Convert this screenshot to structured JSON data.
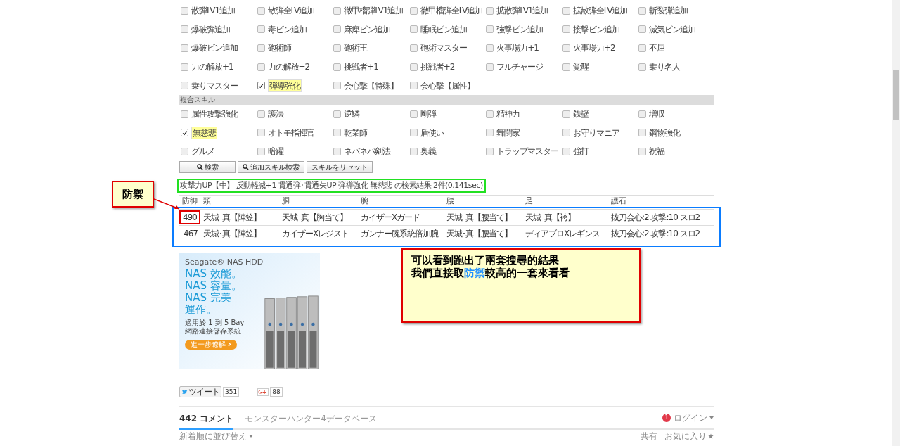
{
  "skill_sections": [
    {
      "items": [
        {
          "label": "散弾LV1追加",
          "checked": false
        },
        {
          "label": "散弾全LV追加",
          "checked": false
        },
        {
          "label": "徹甲榴弾LV1追加",
          "checked": false
        },
        {
          "label": "徹甲榴弾全LV追加",
          "checked": false
        },
        {
          "label": "拡散弾LV1追加",
          "checked": false
        },
        {
          "label": "拡散弾全LV追加",
          "checked": false
        },
        {
          "label": "斬裂弾追加",
          "checked": false
        },
        {
          "label": "爆破弾追加",
          "checked": false
        },
        {
          "label": "毒ビン追加",
          "checked": false
        },
        {
          "label": "麻痺ビン追加",
          "checked": false
        },
        {
          "label": "睡眠ビン追加",
          "checked": false
        },
        {
          "label": "強撃ビン追加",
          "checked": false
        },
        {
          "label": "接撃ビン追加",
          "checked": false
        },
        {
          "label": "減気ビン追加",
          "checked": false
        },
        {
          "label": "爆破ビン追加",
          "checked": false
        },
        {
          "label": "砲術師",
          "checked": false
        },
        {
          "label": "砲術王",
          "checked": false
        },
        {
          "label": "砲術マスター",
          "checked": false
        },
        {
          "label": "火事場力+1",
          "checked": false
        },
        {
          "label": "火事場力+2",
          "checked": false
        },
        {
          "label": "不屈",
          "checked": false
        },
        {
          "label": "力の解放+1",
          "checked": false
        },
        {
          "label": "力の解放+2",
          "checked": false
        },
        {
          "label": "挑戦者+1",
          "checked": false
        },
        {
          "label": "挑戦者+2",
          "checked": false
        },
        {
          "label": "フルチャージ",
          "checked": false
        },
        {
          "label": "覚醒",
          "checked": false
        },
        {
          "label": "乗り名人",
          "checked": false
        },
        {
          "label": "乗りマスター",
          "checked": false
        },
        {
          "label": "弾導強化",
          "checked": true
        },
        {
          "label": "会心撃【特殊】",
          "checked": false
        },
        {
          "label": "会心撃【属性】",
          "checked": false
        }
      ]
    },
    {
      "title": "複合スキル",
      "items": [
        {
          "label": "属性攻撃強化",
          "checked": false
        },
        {
          "label": "護法",
          "checked": false
        },
        {
          "label": "逆鱗",
          "checked": false
        },
        {
          "label": "剛弾",
          "checked": false
        },
        {
          "label": "精神力",
          "checked": false
        },
        {
          "label": "鉄壁",
          "checked": false
        },
        {
          "label": "増収",
          "checked": false
        },
        {
          "label": "無慈悲",
          "checked": true
        },
        {
          "label": "オトモ指揮官",
          "checked": false
        },
        {
          "label": "乾業師",
          "checked": false
        },
        {
          "label": "盾使い",
          "checked": false
        },
        {
          "label": "舞闘家",
          "checked": false
        },
        {
          "label": "お守りマニア",
          "checked": false
        },
        {
          "label": "鋼物強化",
          "checked": false
        },
        {
          "label": "グルメ",
          "checked": false
        },
        {
          "label": "暗躍",
          "checked": false
        },
        {
          "label": "ネバネバ剣法",
          "checked": false
        },
        {
          "label": "奥義",
          "checked": false
        },
        {
          "label": "トラップマスター",
          "checked": false
        },
        {
          "label": "強打",
          "checked": false
        },
        {
          "label": "祝福",
          "checked": false
        }
      ]
    }
  ],
  "buttons": [
    {
      "label": "検索",
      "kind": "search"
    },
    {
      "label": "追加スキル検索",
      "kind": "search"
    },
    {
      "label": "スキルをリセット",
      "kind": "plain"
    }
  ],
  "results": {
    "summary": "攻撃力UP【中】 反動軽減+1 貫通弾･貫通矢UP 弾導強化 無慈悲 の検索結果 2件(0.141sec)",
    "columns": [
      "防御",
      "頭",
      "胴",
      "腕",
      "腰",
      "足",
      "護石"
    ],
    "rows": [
      {
        "cells": [
          "490",
          "天城･真【陣笠】",
          "天城･真【胸当て】",
          "カイザーXガード",
          "天城･真【腰当て】",
          "天城･真【袴】",
          "抜刀会心:2 攻撃:10 スロ2"
        ],
        "marked": true
      },
      {
        "cells": [
          "467",
          "天城･真【陣笠】",
          "カイザーXレジスト",
          "ガンナー腕系統倍加腕",
          "天城･真【腰当て】",
          "ディアブロXレギンス",
          "抜刀会心:2 攻撃:10 スロ2"
        ],
        "marked": false
      }
    ]
  },
  "ad": {
    "brand": "Seagate® NAS HDD",
    "headlines": [
      "NAS 效能。",
      "NAS 容量。",
      "NAS 完美",
      "運作。"
    ],
    "body": [
      "適用於 1 到 5 Bay",
      "網路連接儲存系統"
    ],
    "cta": "進一步瞭解"
  },
  "share": {
    "tweet": "ツイート",
    "tweet_count": "351",
    "plus_count": "88"
  },
  "comments": {
    "tabs": [
      {
        "label": "442 コメント",
        "selected": true
      },
      {
        "label": "モンスターハンター4データベース",
        "selected": false
      }
    ],
    "badge": "1",
    "login": "ログイン",
    "sort": "新着順に並び替え",
    "share": "共有",
    "favorite": "お気に入り"
  },
  "annotations": {
    "label": "防禦",
    "note": [
      [
        {
          "text": "可以看到跑出了兩套搜尋的結果",
          "emphasis": false
        }
      ],
      [
        {
          "text": "我們直接取",
          "emphasis": false
        },
        {
          "text": "防禦",
          "emphasis": true
        },
        {
          "text": "較高的一套來看看",
          "emphasis": false
        }
      ]
    ]
  }
}
